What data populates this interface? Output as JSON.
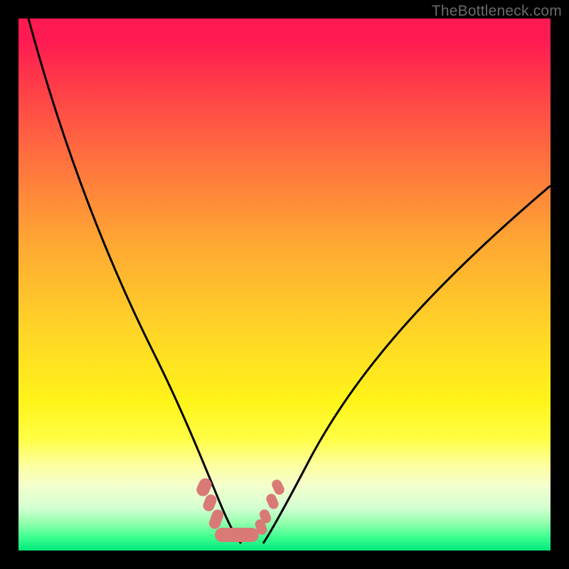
{
  "watermark": "TheBottleneck.com",
  "colors": {
    "frame": "#000000",
    "curve": "#000000",
    "blob": "#d97a76",
    "gradient_top": "#ff1a52",
    "gradient_bottom": "#00e97c"
  },
  "chart_data": {
    "type": "line",
    "title": "",
    "xlabel": "",
    "ylabel": "",
    "xlim": [
      0,
      100
    ],
    "ylim": [
      0,
      100
    ],
    "series": [
      {
        "name": "left-curve",
        "x": [
          2,
          5,
          10,
          15,
          20,
          25,
          27,
          29,
          31,
          33,
          35,
          36.5,
          38,
          39.2,
          40.4,
          41.8
        ],
        "values": [
          100,
          88,
          72,
          58,
          45,
          32,
          27,
          22,
          18,
          14,
          10,
          7.5,
          5.3,
          3.8,
          2.6,
          1.3
        ]
      },
      {
        "name": "right-curve",
        "x": [
          46,
          48,
          50,
          53,
          57,
          62,
          68,
          75,
          83,
          91,
          100
        ],
        "values": [
          1.3,
          3.3,
          6,
          10,
          15,
          21,
          29,
          38,
          48,
          58,
          68
        ]
      }
    ],
    "annotations": {
      "bottom_markers_left": [
        {
          "x": 34.2,
          "y": 12.3
        },
        {
          "x": 35.3,
          "y": 9.3
        },
        {
          "x": 36.5,
          "y": 6.3
        }
      ],
      "bottom_markers_right": [
        {
          "x": 45.5,
          "y": 4.0
        },
        {
          "x": 46.3,
          "y": 6.0
        },
        {
          "x": 47.6,
          "y": 9.0
        },
        {
          "x": 48.6,
          "y": 11.7
        }
      ],
      "bottom_bar": {
        "x_start": 36.9,
        "x_end": 44.9,
        "y": 1.9
      }
    }
  }
}
